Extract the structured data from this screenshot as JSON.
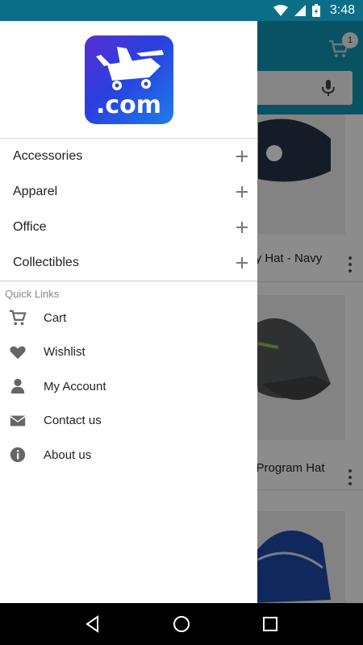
{
  "status_bar": {
    "time": "3:48"
  },
  "app": {
    "cart_count": "1",
    "products": [
      {
        "name": "dgy Hat - Navy"
      },
      {
        "name": "er Program Hat"
      },
      {
        "name": ""
      }
    ]
  },
  "drawer": {
    "logo_text": ".com",
    "categories": [
      {
        "label": "Accessories"
      },
      {
        "label": "Apparel"
      },
      {
        "label": "Office"
      },
      {
        "label": "Collectibles"
      }
    ],
    "quick_links_title": "Quick Links",
    "quick_links": [
      {
        "label": "Cart",
        "icon": "cart-icon"
      },
      {
        "label": "Wishlist",
        "icon": "heart-icon"
      },
      {
        "label": "My Account",
        "icon": "person-icon"
      },
      {
        "label": "Contact us",
        "icon": "mail-icon"
      },
      {
        "label": "About us",
        "icon": "info-icon"
      }
    ]
  },
  "colors": {
    "status_bar": "#0b6e86",
    "toolbar": "#1296b4",
    "icon_gray": "#666666"
  }
}
